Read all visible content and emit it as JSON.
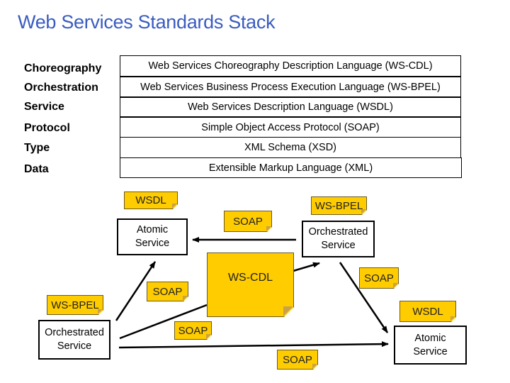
{
  "title": "Web Services Standards Stack",
  "colors": {
    "title": "#3a5cc0",
    "note_fill": "#ffcc00",
    "box_border": "#000000"
  },
  "layers": [
    {
      "label": "Choreography",
      "standard": "Web Services Choreography Description Language (WS-CDL)"
    },
    {
      "label": "Orchestration",
      "standard": "Web Services Business Process Execution Language (WS-BPEL)"
    },
    {
      "label": "Service",
      "standard": "Web Services Description Language (WSDL)"
    },
    {
      "label": "Protocol",
      "standard": "Simple Object Access Protocol (SOAP)"
    },
    {
      "label": "Type",
      "standard": "XML Schema (XSD)"
    },
    {
      "label": "Data",
      "standard": "Extensible Markup Language (XML)"
    }
  ],
  "diagram": {
    "services": {
      "atomic_top": {
        "line1": "Atomic",
        "line2": "Service"
      },
      "orchestrated_top": {
        "line1": "Orchestrated",
        "line2": "Service"
      },
      "orchestrated_bottom": {
        "line1": "Orchestrated",
        "line2": "Service"
      },
      "atomic_bottom": {
        "line1": "Atomic",
        "line2": "Service"
      }
    },
    "notes": {
      "wsdl_top": "WSDL",
      "soap_top": "SOAP",
      "wsbpel_top": "WS-BPEL",
      "wscdl": "WS-CDL",
      "soap_right": "SOAP",
      "soap_left": "SOAP",
      "wsbpel_left": "WS-BPEL",
      "wsdl_right": "WSDL",
      "soap_lower": "SOAP",
      "soap_bottom": "SOAP"
    }
  }
}
